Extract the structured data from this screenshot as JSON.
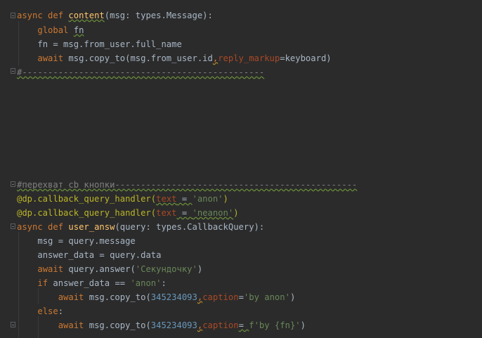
{
  "editor": {
    "block1": {
      "async_kw": "async",
      "def_kw": "def",
      "func_name": "content",
      "sig_rest": "(msg: types.Message):",
      "global_kw": "global",
      "global_var": "fn",
      "assign_line": "fn = msg.from_user.full_name",
      "await_kw": "await",
      "copy_call": "msg.copy_to(msg.from_user.id",
      "comma": ",",
      "reply_kw": "reply_markup",
      "reply_val": "=keyboard)",
      "separator": "#-----------------------------------------------"
    },
    "block2": {
      "comment": "#перехват cb кнопки-----------------------------------------------",
      "dec1_name": "@dp.callback_query_handler(",
      "dec1_param": "text",
      "dec1_eq": " = ",
      "dec1_str": "'anon'",
      "dec1_close": ")",
      "dec2_name": "@dp.callback_query_handler(",
      "dec2_param": "text",
      "dec2_eq": " = ",
      "dec2_str": "'neanon'",
      "dec2_close": ")",
      "async_kw": "async",
      "def_kw": "def",
      "func_name": "user_answ",
      "sig_rest": "(query: types.CallbackQuery):",
      "line_msg": "msg = query.message",
      "line_answer_data": "answer_data = query.data",
      "await_kw": "await",
      "answer_call": "query.answer(",
      "answer_str": "'Секундочку'",
      "answer_close": ")",
      "if_kw": "if",
      "if_cond": "answer_data == ",
      "if_str": "'anon'",
      "if_colon": ":",
      "copy_call": "msg.copy_to(",
      "chat_id": "345234093",
      "comma": ",",
      "caption_kw": "caption",
      "eq": "=",
      "caption1": "'by anon'",
      "close_paren": ")",
      "else_kw": "else",
      "else_colon": ":",
      "eq_space": "= ",
      "caption2": "f'by {fn}'"
    }
  }
}
